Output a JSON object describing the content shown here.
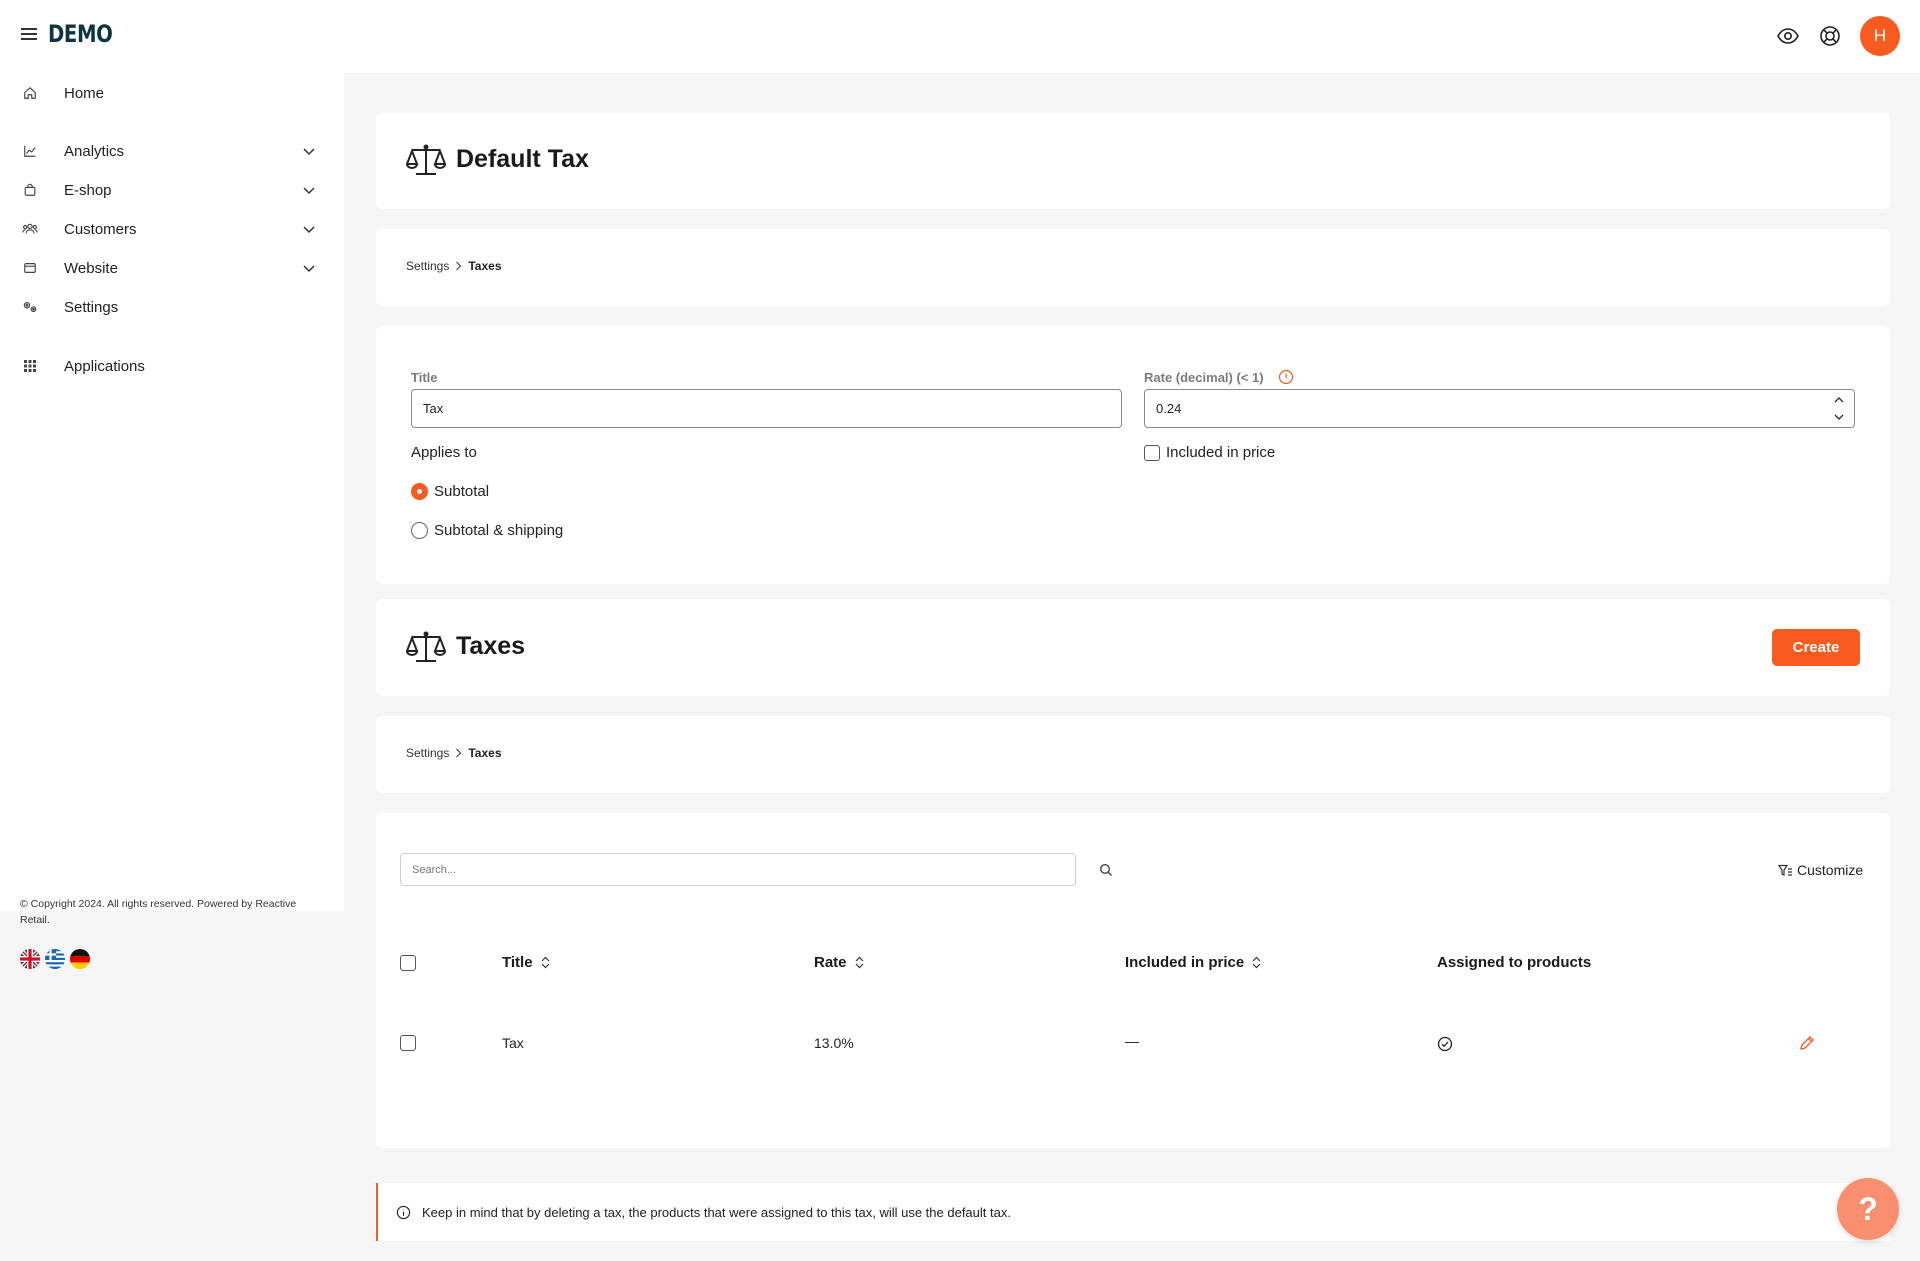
{
  "brand": {
    "logo_text": "DEMO",
    "accent_color": "#f85a20"
  },
  "topbar": {
    "user_initial": "H"
  },
  "sidebar": {
    "items": [
      {
        "label": "Home"
      },
      {
        "label": "Analytics"
      },
      {
        "label": "E-shop"
      },
      {
        "label": "Customers"
      },
      {
        "label": "Website"
      },
      {
        "label": "Settings"
      },
      {
        "label": "Applications"
      }
    ],
    "copyright": "© Copyright 2024. All rights reserved. Powered by Reactive Retail."
  },
  "default_tax": {
    "title": "Default Tax",
    "breadcrumb": {
      "parent": "Settings",
      "current": "Taxes"
    },
    "form": {
      "title_label": "Title",
      "title_value": "Tax",
      "rate_label": "Rate (decimal) (< 1)",
      "rate_value": "0.24",
      "applies_to_label": "Applies to",
      "option_subtotal": "Subtotal",
      "option_subtotal_shipping": "Subtotal & shipping",
      "included_in_price_label": "Included in price"
    }
  },
  "taxes": {
    "title": "Taxes",
    "create_label": "Create",
    "breadcrumb": {
      "parent": "Settings",
      "current": "Taxes"
    },
    "search_placeholder": "Search...",
    "customize_label": "Customize",
    "columns": {
      "title": "Title",
      "rate": "Rate",
      "included": "Included in price",
      "assigned": "Assigned to products"
    },
    "rows": [
      {
        "title": "Tax",
        "rate": "13.0%",
        "included": "—"
      }
    ]
  },
  "notice": {
    "text": "Keep in mind that by deleting a tax, the products that were assigned to this tax, will use the default tax."
  },
  "help": {
    "label": "?"
  }
}
